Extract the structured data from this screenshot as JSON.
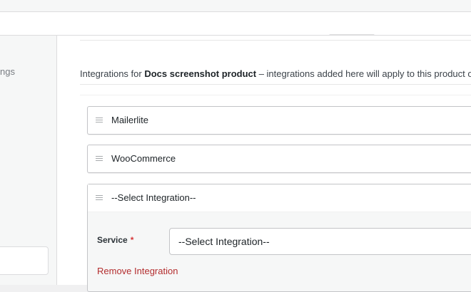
{
  "sidebar": {
    "partial_label": "ngs"
  },
  "intro": {
    "prefix": "Integrations for ",
    "product_name": "Docs screenshot product",
    "suffix": " – integrations added here will apply to this product o"
  },
  "integrations": [
    {
      "name": "Mailerlite"
    },
    {
      "name": "WooCommerce"
    }
  ],
  "new_integration": {
    "title": "--Select Integration--",
    "service_label": "Service",
    "required_marker": "*",
    "service_value": "--Select Integration--",
    "remove_label": "Remove Integration"
  }
}
